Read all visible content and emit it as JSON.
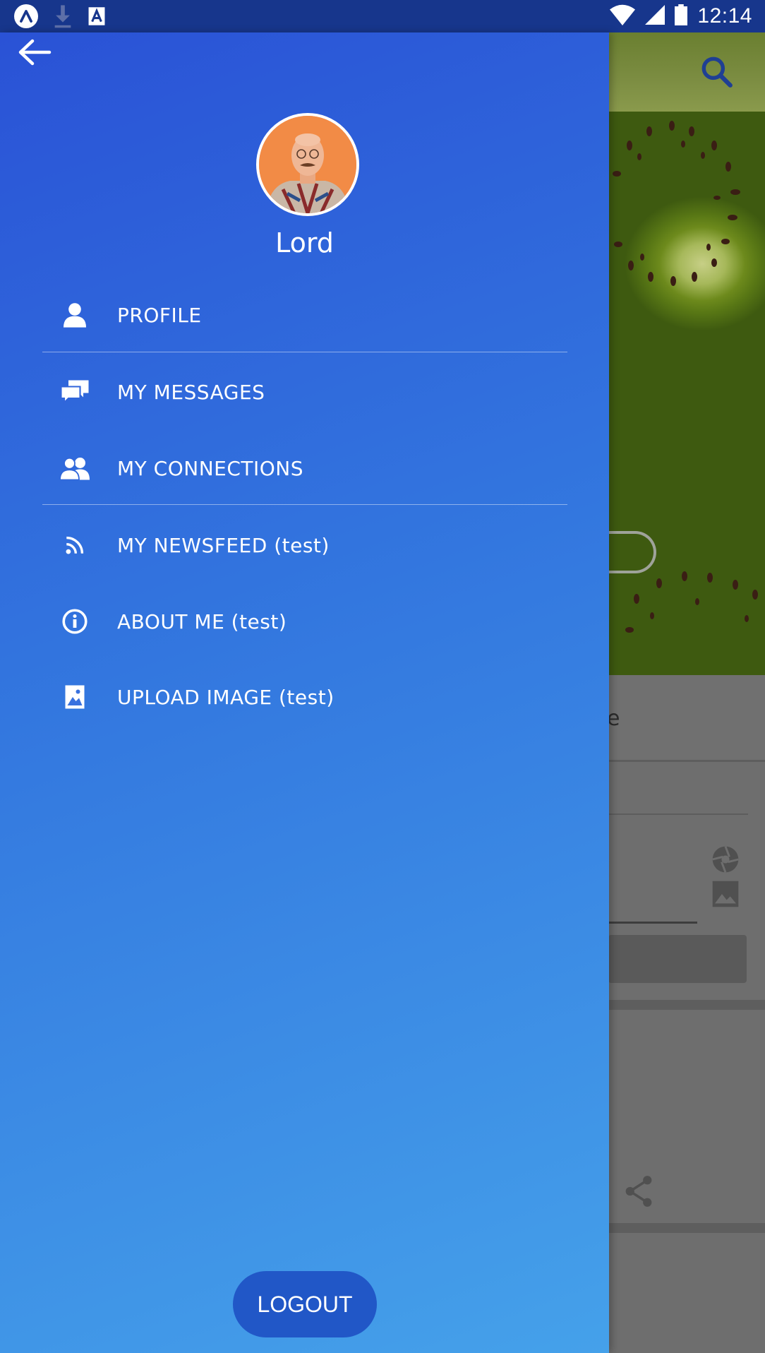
{
  "status_bar": {
    "time": "12:14",
    "icons": [
      "expo-icon",
      "download-icon",
      "a-app-icon",
      "wifi-icon",
      "signal-icon",
      "battery-icon"
    ]
  },
  "drawer": {
    "back_icon": "arrow-left-icon",
    "user_name": "Lord",
    "menu": [
      {
        "label": "PROFILE",
        "icon": "person-icon"
      },
      {
        "label": "MY MESSAGES",
        "icon": "chat-bubbles-icon"
      },
      {
        "label": "MY CONNECTIONS",
        "icon": "people-icon"
      },
      {
        "label": "MY NEWSFEED (test)",
        "icon": "rss-icon"
      },
      {
        "label": "ABOUT ME (test)",
        "icon": "info-icon"
      },
      {
        "label": "UPLOAD IMAGE (test)",
        "icon": "image-icon"
      }
    ],
    "logout_label": "LOGOUT"
  },
  "background_app": {
    "partial_text": "e",
    "icons": [
      "search-icon",
      "aperture-icon",
      "image-icon",
      "share-icon"
    ]
  },
  "colors": {
    "drawer_top": "#2a52d6",
    "drawer_bottom": "#45a1ea",
    "status_bar": "#17368c",
    "logout_button": "#2157c7"
  }
}
